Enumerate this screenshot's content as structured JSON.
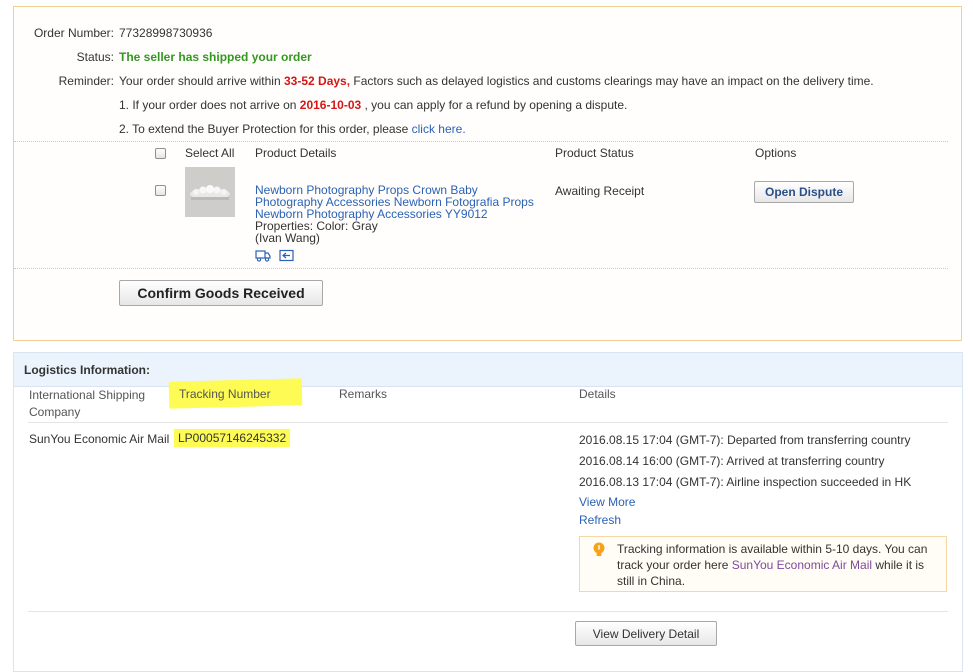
{
  "order": {
    "number_label": "Order Number:",
    "number_value": "77328998730936",
    "status_label": "Status:",
    "status_value": "The seller has shipped your order",
    "reminder_label": "Reminder:",
    "reminder_pre": "Your order should arrive within",
    "reminder_days": "33-52 Days,",
    "reminder_post": "Factors such as delayed logistics and customs clearings may have an impact on the delivery time.",
    "note1_pre": "1. If your order does not arrive on",
    "note1_date": "2016-10-03",
    "note1_post": ", you can apply for a refund by opening a dispute.",
    "note2_pre": "2. To extend the Buyer Protection for this order, please",
    "note2_link": "click here."
  },
  "product_table": {
    "select_all": "Select All",
    "col_details": "Product Details",
    "col_status": "Product Status",
    "col_options": "Options",
    "item": {
      "title_line1": "Newborn Photography Props Crown Baby",
      "title_line2": "Photography Accessories Newborn Fotografia Props",
      "title_line3": "Newborn Photography Accessories YY9012",
      "properties": "Properties: Color: Gray",
      "seller": "(Ivan Wang)",
      "status": "Awaiting Receipt",
      "option_button": "Open Dispute"
    },
    "confirm_button": "Confirm Goods Received"
  },
  "logistics": {
    "header": "Logistics Information:",
    "col_company_line1": "International Shipping",
    "col_company_line2": "Company",
    "col_tracking": "Tracking Number",
    "col_remarks": "Remarks",
    "col_details": "Details",
    "row": {
      "company": "SunYou Economic Air Mail",
      "tracking": "LP00057146245332",
      "events": [
        "2016.08.15 17:04 (GMT-7): Departed from transferring country",
        "2016.08.14 16:00 (GMT-7): Arrived at transferring country",
        "2016.08.13 17:04 (GMT-7): Airline inspection succeeded in HK"
      ],
      "view_more": "View More",
      "refresh": "Refresh",
      "info_line1": "Tracking information is available within 5-10 days. You can",
      "info_line2_pre": "track your order here",
      "info_link": "SunYou Economic Air Mail",
      "info_line2_post": "while it is",
      "info_line3": "still in China."
    },
    "delivery_button": "View Delivery Detail"
  },
  "colors": {
    "status_green": "#359722",
    "highlight_red": "#d51616",
    "link_blue": "#2b62b5",
    "marker_yellow": "#fdfb54"
  }
}
